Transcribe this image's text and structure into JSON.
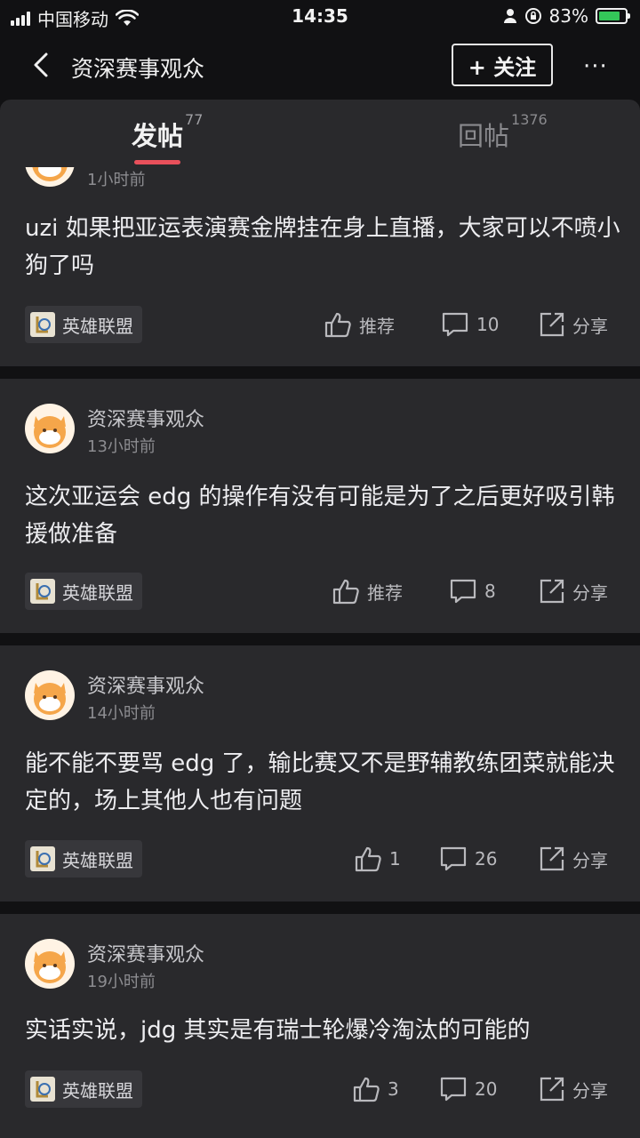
{
  "status_bar": {
    "carrier": "中国移动",
    "time": "14:35",
    "battery": "83%",
    "battery_level": 0.83
  },
  "nav": {
    "title": "资深赛事观众",
    "follow_label": "+ 关注",
    "more_label": "···"
  },
  "tabs": [
    {
      "label": "发帖",
      "count": "77",
      "active": true
    },
    {
      "label": "回帖",
      "count": "1376",
      "active": false
    }
  ],
  "posts": [
    {
      "username": "",
      "time": "1小时前",
      "content": "uzi 如果把亚运表演赛金牌挂在身上直播，大家可以不喷小狗了吗",
      "tag": "英雄联盟",
      "like": "推荐",
      "comments": "10",
      "share": "分享"
    },
    {
      "username": "资深赛事观众",
      "time": "13小时前",
      "content": "这次亚运会 edg 的操作有没有可能是为了之后更好吸引韩援做准备",
      "tag": "英雄联盟",
      "like": "推荐",
      "comments": "8",
      "share": "分享"
    },
    {
      "username": "资深赛事观众",
      "time": "14小时前",
      "content": "能不能不要骂 edg 了，输比赛又不是野辅教练团菜就能决定的，场上其他人也有问题",
      "tag": "英雄联盟",
      "like": "1",
      "comments": "26",
      "share": "分享"
    },
    {
      "username": "资深赛事观众",
      "time": "19小时前",
      "content": "实话实说，jdg 其实是有瑞士轮爆冷淘汰的可能的",
      "tag": "英雄联盟",
      "like": "3",
      "comments": "20",
      "share": "分享"
    }
  ],
  "colors": {
    "background": "#111113",
    "card": "#29292c",
    "accent": "#e8505b"
  }
}
